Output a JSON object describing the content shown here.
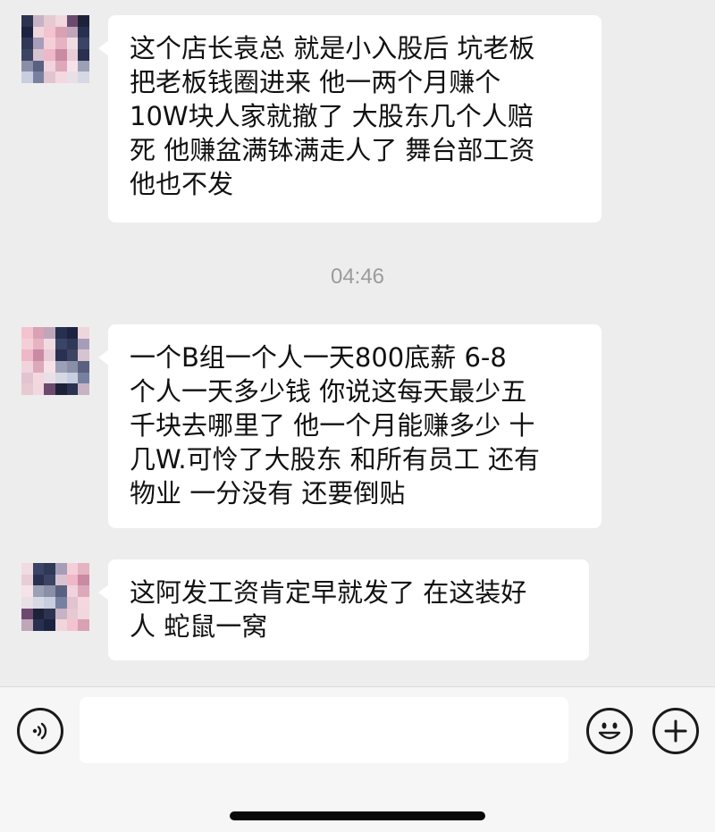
{
  "messages": [
    {
      "text_lines": [
        "这个店长袁总 就是小入股后 坑老板",
        "把老板钱圈进来 他一两个月赚个",
        "10W块人家就撤了 大股东几个人赔",
        "死 他赚盆满钵满走人了 舞台部工资",
        "他也不发"
      ]
    },
    {
      "text_lines": [
        "一个B组一个人一天800底薪 6-8",
        "个人一天多少钱 你说这每天最少五",
        "千块去哪里了 他一个月能赚多少 十",
        "几W.可怜了大股东 和所有员工 还有",
        "物业 一分没有 还要倒贴"
      ]
    },
    {
      "text_lines": [
        "这阿发工资肯定早就发了 在这装好",
        "人 蛇鼠一窝"
      ]
    }
  ],
  "timestamp": "04:46",
  "input_bar": {
    "voice_icon": "voice-icon",
    "emoji_icon": "emoji-icon",
    "plus_icon": "plus-icon",
    "input_value": ""
  },
  "colors": {
    "background": "#ededed",
    "bubble": "#ffffff",
    "timestamp": "#9b9b9b"
  }
}
